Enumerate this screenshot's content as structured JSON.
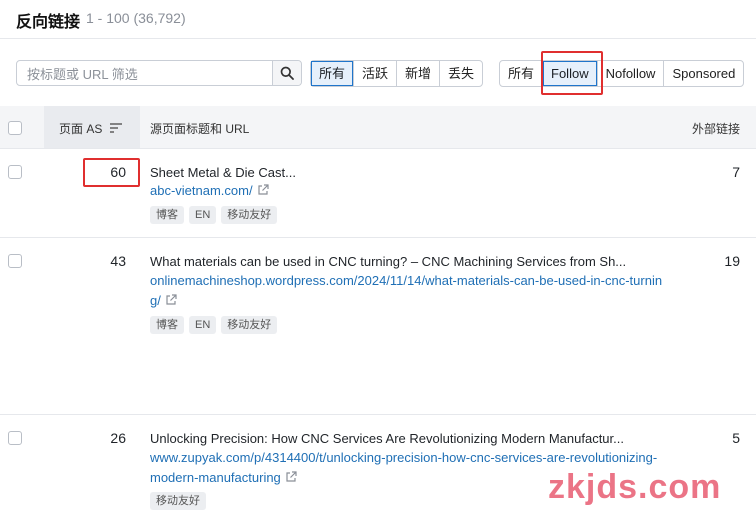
{
  "header": {
    "title": "反向链接",
    "range": "1 - 100 (36,792)"
  },
  "search": {
    "placeholder": "按标题或 URL 筛选"
  },
  "filters_group1": [
    {
      "label": "所有",
      "active": true
    },
    {
      "label": "活跃",
      "active": false
    },
    {
      "label": "新增",
      "active": false
    },
    {
      "label": "丢失",
      "active": false
    }
  ],
  "filters_group2": [
    {
      "label": "所有",
      "active": false
    },
    {
      "label": "Follow",
      "active": true
    },
    {
      "label": "Nofollow",
      "active": false
    },
    {
      "label": "Sponsored",
      "active": false
    }
  ],
  "table": {
    "columns": {
      "page_as": "页面 AS",
      "source": "源页面标题和 URL",
      "external_links": "外部链接"
    },
    "rows": [
      {
        "as": "60",
        "title": "Sheet Metal & Die Cast...",
        "url": "abc-vietnam.com/",
        "tags": [
          "博客",
          "EN",
          "移动友好"
        ],
        "external_links": "7"
      },
      {
        "as": "43",
        "title": "What materials can be used in CNC turning? – CNC Machining Services from Sh...",
        "url": "onlinemachineshop.wordpress.com/2024/11/14/what-materials-can-be-used-in-cnc-turning/",
        "tags": [
          "博客",
          "EN",
          "移动友好"
        ],
        "external_links": "19"
      },
      {
        "as": "26",
        "title": "Unlocking Precision: How CNC Services Are Revolutionizing Modern Manufactur...",
        "url": "www.zupyak.com/p/4314400/t/unlocking-precision-how-cnc-services-are-revolutionizing-modern-manufacturing",
        "tags": [
          "移动友好"
        ],
        "external_links": "5"
      }
    ]
  },
  "colors": {
    "accent": "#1f75cb",
    "link": "#1f6fb5",
    "highlight": "#e02f2f",
    "watermark": "#e9667a"
  },
  "watermark": "zkjds.com"
}
